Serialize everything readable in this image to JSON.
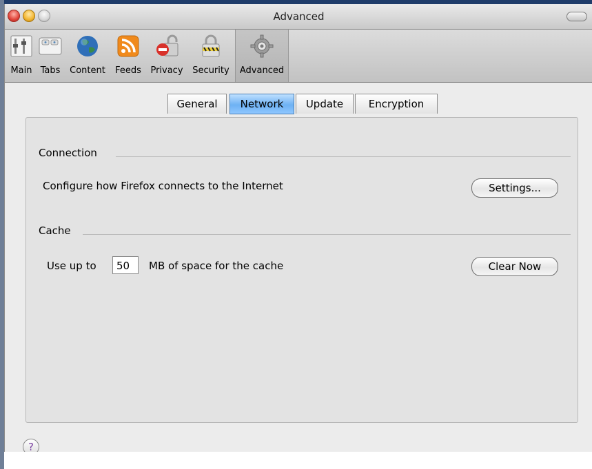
{
  "window": {
    "title": "Advanced"
  },
  "toolbar": {
    "items": [
      {
        "label": "Main",
        "icon": "main-switch-icon"
      },
      {
        "label": "Tabs",
        "icon": "tabs-icon"
      },
      {
        "label": "Content",
        "icon": "globe-icon"
      },
      {
        "label": "Feeds",
        "icon": "rss-feed-icon"
      },
      {
        "label": "Privacy",
        "icon": "privacy-lock-icon"
      },
      {
        "label": "Security",
        "icon": "security-padlock-icon"
      },
      {
        "label": "Advanced",
        "icon": "gear-icon",
        "selected": true
      }
    ]
  },
  "tabs": [
    {
      "label": "General"
    },
    {
      "label": "Network",
      "active": true
    },
    {
      "label": "Update"
    },
    {
      "label": "Encryption"
    }
  ],
  "connection": {
    "heading": "Connection",
    "description": "Configure how Firefox connects to the Internet",
    "settings_button": "Settings..."
  },
  "cache": {
    "heading": "Cache",
    "prefix": "Use up to",
    "size_value": "50",
    "suffix": "MB of space for the cache",
    "clear_button": "Clear Now"
  },
  "help": {
    "label": "?"
  },
  "colors": {
    "active_tab": "#6eb1f3",
    "help_glyph": "#7a3fa0"
  }
}
